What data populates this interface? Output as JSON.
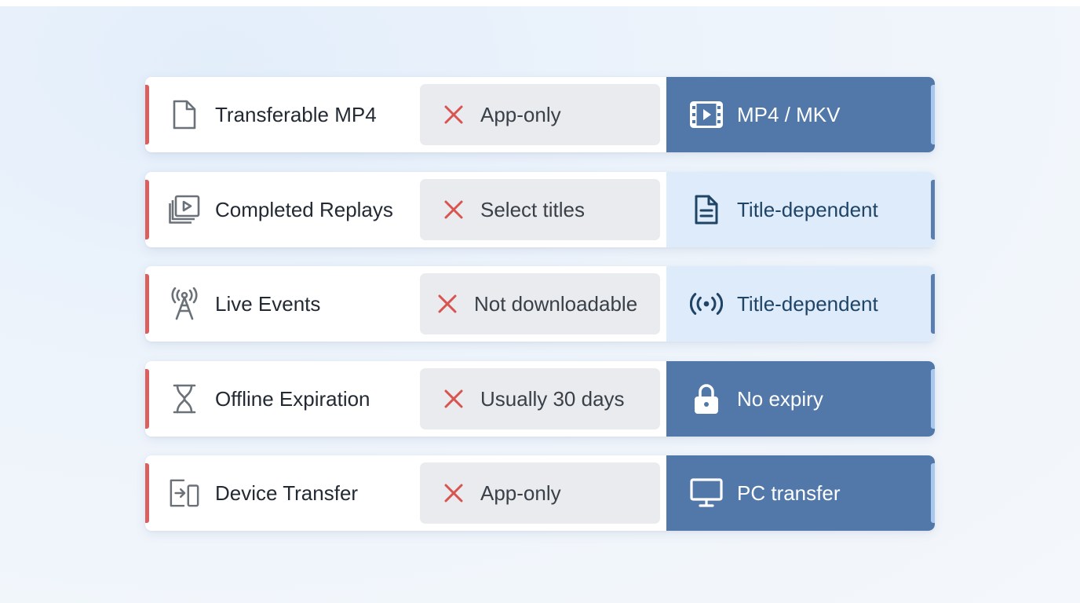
{
  "colors": {
    "negative_accent": "#d9605e",
    "x_mark": "#d9534f",
    "result_dark": "#5178a8",
    "result_light": "#deebfb",
    "result_light_text": "#1f4466"
  },
  "rows": [
    {
      "feature": "Transferable MP4",
      "feature_icon": "file-icon",
      "app_value": "App-only",
      "result_value": "MP4 / MKV",
      "result_icon": "film-icon",
      "result_style": "dark"
    },
    {
      "feature": "Completed Replays",
      "feature_icon": "replay-icon",
      "app_value": "Select titles",
      "result_value": "Title-dependent",
      "result_icon": "document-icon",
      "result_style": "light"
    },
    {
      "feature": "Live Events",
      "feature_icon": "antenna-icon",
      "app_value": "Not downloadable",
      "result_value": "Title-dependent",
      "result_icon": "broadcast-icon",
      "result_style": "light"
    },
    {
      "feature": "Offline Expiration",
      "feature_icon": "hourglass-icon",
      "app_value": "Usually 30 days",
      "result_value": "No expiry",
      "result_icon": "lock-icon",
      "result_style": "dark"
    },
    {
      "feature": "Device Transfer",
      "feature_icon": "device-transfer-icon",
      "app_value": "App-only",
      "result_value": "PC transfer",
      "result_icon": "monitor-icon",
      "result_style": "dark"
    }
  ]
}
